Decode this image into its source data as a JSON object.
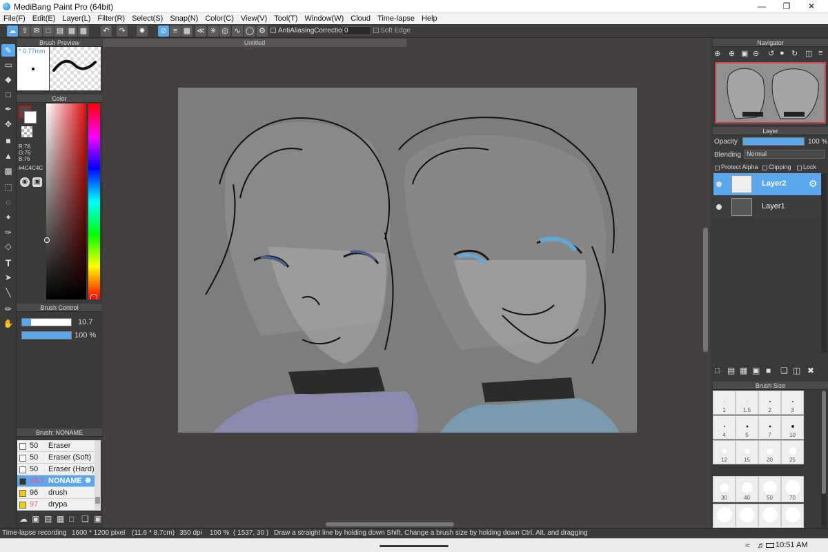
{
  "window": {
    "title": "MediBang Paint Pro (64bit)"
  },
  "menu": [
    "File(F)",
    "Edit(E)",
    "Layer(L)",
    "Filter(R)",
    "Select(S)",
    "Snap(N)",
    "Color(C)",
    "View(V)",
    "Tool(T)",
    "Window(W)",
    "Cloud",
    "Time-lapse",
    "Help"
  ],
  "toolbar": {
    "antialiasing_label": "AntiAliasing",
    "correction_label": "Correction",
    "correction_value": "0",
    "soft_edge_label": "Soft Edge"
  },
  "panels": {
    "brush_preview": {
      "title": "Brush Preview",
      "size": "* 0.77mm"
    },
    "color": {
      "title": "Color",
      "r": "R:76",
      "g": "G:76",
      "b": "B:76",
      "hex": "#4C4C4C"
    },
    "brush_control": {
      "title": "Brush Control",
      "size_value": "10.7",
      "opacity_value": "100 %"
    },
    "brush_list": {
      "title": "Brush: NONAME",
      "items": [
        {
          "size": "50",
          "name": "Eraser",
          "color": "#ffffff"
        },
        {
          "size": "50",
          "name": "Eraser (Soft)",
          "color": "#ffffff"
        },
        {
          "size": "50",
          "name": "Eraser (Hard)",
          "color": "#ffffff"
        },
        {
          "size": "10.7",
          "name": "NONAME",
          "color": "#333333"
        },
        {
          "size": "96",
          "name": "drush",
          "color": "#f0d000"
        },
        {
          "size": "97",
          "name": "drypa",
          "color": "#f0d000"
        }
      ]
    }
  },
  "document": {
    "tab": "Untitled"
  },
  "navigator": {
    "title": "Navigator"
  },
  "layer_panel": {
    "title": "Layer",
    "opacity_label": "Opacity",
    "opacity_value": "100 %",
    "blending_label": "Blending",
    "blending_value": "Normal",
    "protect_alpha": "Protect Alpha",
    "clipping": "Clipping",
    "lock": "Lock",
    "layers": [
      {
        "name": "Layer2",
        "selected": true
      },
      {
        "name": "Layer1",
        "selected": false
      }
    ]
  },
  "brush_size_panel": {
    "title": "Brush Size",
    "sizes": [
      "1",
      "1.5",
      "2",
      "3",
      "4",
      "5",
      "7",
      "10",
      "12",
      "15",
      "20",
      "25",
      "30",
      "40",
      "50",
      "70"
    ]
  },
  "status": {
    "recording": "Time-lapse recording",
    "pixels": "1600 * 1200 pixel",
    "cm": "(11.6 * 8.7cm)",
    "dpi": "350 dpi",
    "zoom": "100 %",
    "coords": "( 1537, 30 )",
    "hint": "Draw a straight line by holding down Shift, Change a brush size by holding down Ctrl, Alt, and dragging"
  },
  "taskbar": {
    "time": "10:51 AM"
  }
}
